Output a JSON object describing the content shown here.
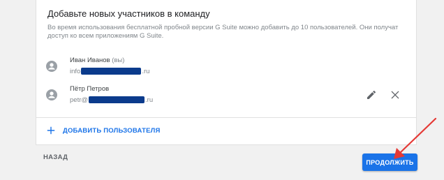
{
  "card": {
    "title": "Добавьте новых участников в команду",
    "description": "Во время использования бесплатной пробной версии G Suite можно добавить до 10 пользователей. Они получат доступ ко всем приложениям G Suite."
  },
  "users": [
    {
      "name": "Иван Иванов",
      "you_suffix": "(вы)",
      "email_prefix": "info",
      "email_suffix": ".ru",
      "avatar_icon": "person-circle-icon"
    },
    {
      "name": "Пётр Петров",
      "email_prefix": "petr@",
      "email_suffix": ".ru",
      "avatar_icon": "person-circle-icon",
      "actions": [
        "edit-icon",
        "close-icon"
      ]
    }
  ],
  "add_user": {
    "label": "ДОБАВИТЬ ПОЛЬЗОВАТЕЛЯ",
    "icon": "plus-icon"
  },
  "footer": {
    "back_label": "НАЗАД",
    "continue_label": "ПРОДОЛЖИТЬ"
  },
  "colors": {
    "accent": "#1a73e8",
    "redaction": "#0b3b8c",
    "annotation_arrow": "#e53935"
  }
}
